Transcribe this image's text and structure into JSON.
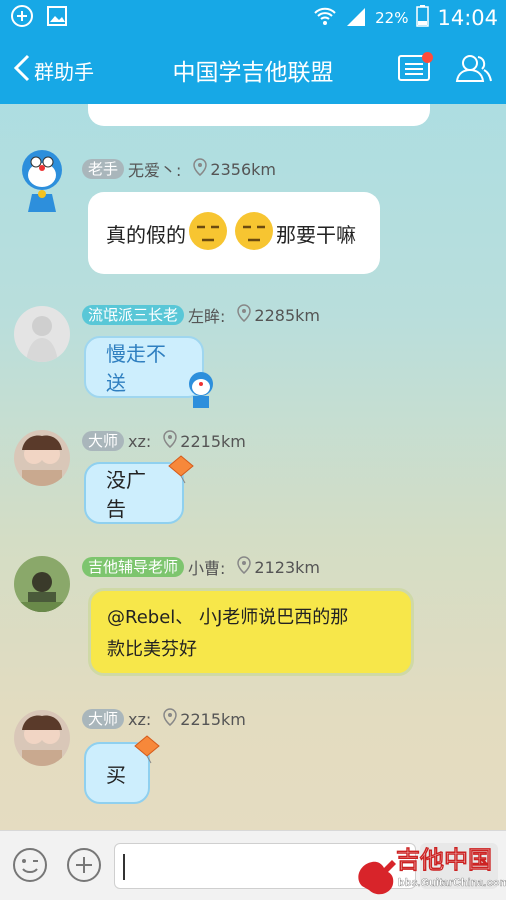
{
  "status_bar": {
    "battery": "22%",
    "time": "14:04"
  },
  "title_bar": {
    "back_label": "群助手",
    "title": "中国学吉他联盟"
  },
  "messages": [
    {
      "sender_badge": "老手",
      "sender_name": "无爱丶:",
      "distance": "2356km",
      "text_before": "真的假的",
      "text_after": "那要干嘛"
    },
    {
      "sender_badge": "流氓派三长老",
      "sender_name": "左眸:",
      "distance": "2285km",
      "text": "慢走不送"
    },
    {
      "sender_badge": "大师",
      "sender_name": "xz:",
      "distance": "2215km",
      "text": "没广告"
    },
    {
      "sender_badge": "吉他辅导老师",
      "sender_name": "小曹:",
      "distance": "2123km",
      "text_line1": "@Rebel、 小J老师说巴西的那",
      "text_line2": "款比美芬好"
    },
    {
      "sender_badge": "大师",
      "sender_name": "xz:",
      "distance": "2215km",
      "text": "买"
    }
  ],
  "watermark": {
    "line1": "吉他中国",
    "line2": "bbs.GuitarChina.com"
  },
  "colors": {
    "accent": "#17a8e6",
    "badge_gray": "#a9b6bb",
    "badge_teal": "#59c7d7",
    "badge_green": "#7dc56e"
  }
}
